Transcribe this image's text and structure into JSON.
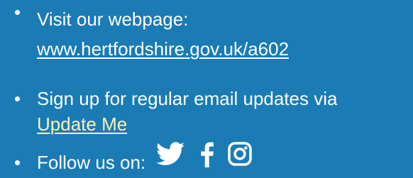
{
  "colors": {
    "background": "#1a7bb5",
    "text": "#ffffff",
    "link_highlight": "#fff2b3"
  },
  "items": [
    {
      "bullet": "•",
      "line1": "Visit our webpage:",
      "link": "www.hertfordshire.gov.uk/a602"
    },
    {
      "bullet": "•",
      "line1": "Sign up for regular email updates via",
      "link": "Update Me"
    },
    {
      "bullet": "•",
      "line1": "Follow us on:",
      "icons": [
        "twitter-icon",
        "facebook-icon",
        "instagram-icon"
      ]
    }
  ]
}
